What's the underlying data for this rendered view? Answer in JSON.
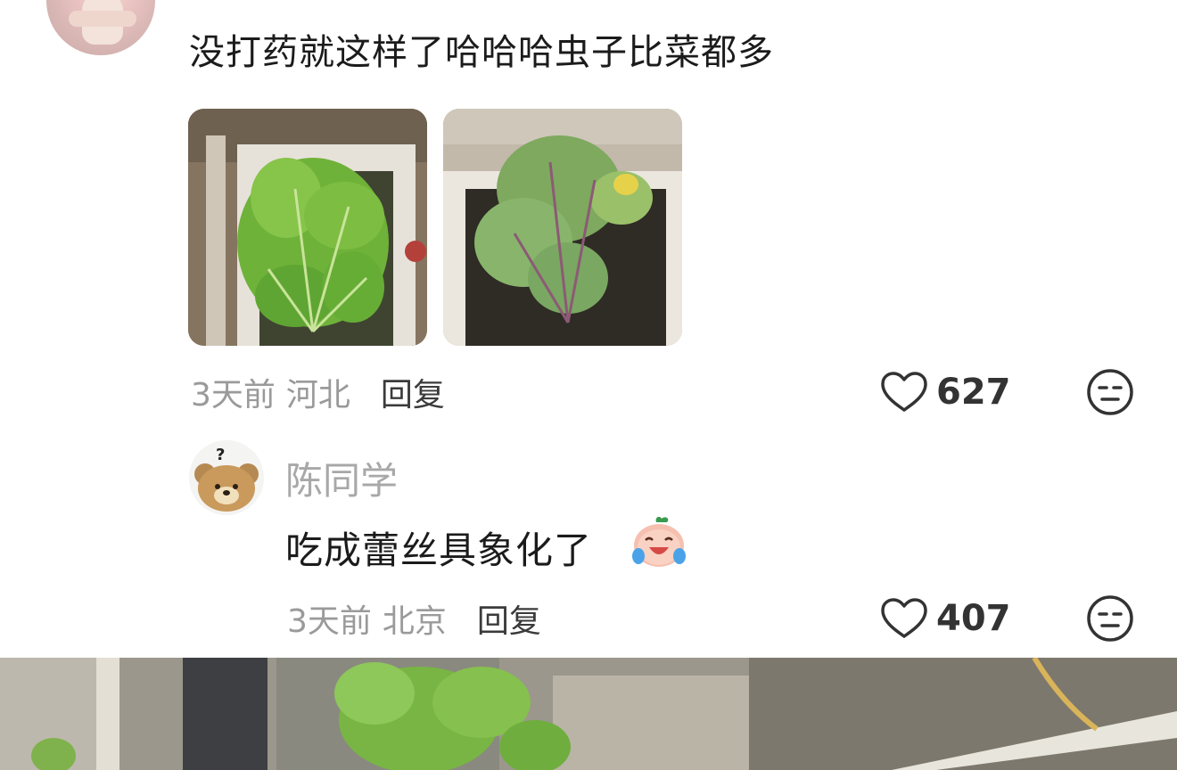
{
  "comment": {
    "text": "没打药就这样了哈哈哈虫子比菜都多",
    "time": "3天前",
    "location": "河北",
    "reply_label": "回复",
    "likes": "627",
    "images": [
      "planter-photo-1",
      "planter-photo-2"
    ]
  },
  "sub_comment": {
    "username": "陈同学",
    "text": "吃成蕾丝具象化了",
    "emoji": "laughing-crying-peach-emoji",
    "time": "3天前",
    "location": "北京",
    "reply_label": "回复",
    "likes": "407"
  },
  "icons": {
    "like": "heart-outline-icon",
    "dislike": "neutral-face-icon"
  },
  "colors": {
    "text": "#1b1b1b",
    "meta": "#9a9a9a",
    "reply": "#3b3b3b",
    "username": "#a8a8a8",
    "leaf_green": "#6fb23a"
  }
}
